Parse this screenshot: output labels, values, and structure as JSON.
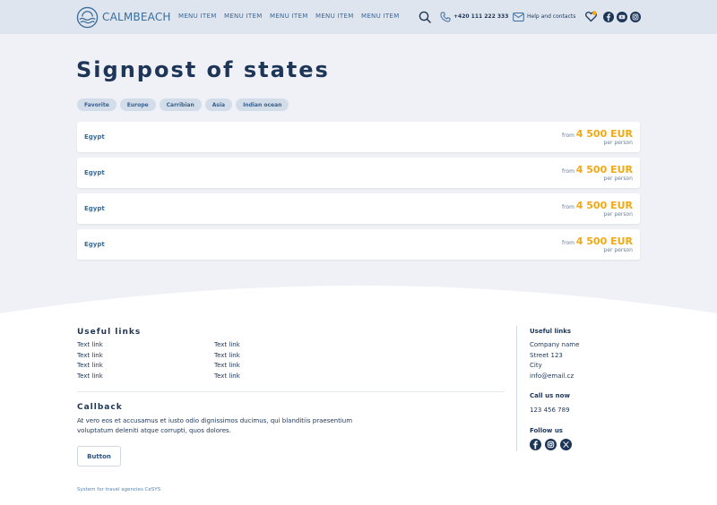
{
  "header": {
    "logo_text": "CALMBEACH",
    "menu": [
      "MENU ITEM",
      "MENU ITEM",
      "MENU ITEM",
      "MENU ITEM",
      "MENU ITEM"
    ],
    "phone": "+420 111 222 333",
    "help": "Help and contacts",
    "icons": [
      "search-icon",
      "phone-icon",
      "mail-icon",
      "heart-icon",
      "facebook-icon",
      "youtube-icon",
      "instagram-icon"
    ]
  },
  "main": {
    "title": "Signpost of states",
    "chips": [
      "Favorite",
      "Europe",
      "Carribian",
      "Asia",
      "Indian ocean"
    ],
    "cards": [
      {
        "name": "Egypt",
        "from": "from",
        "price": "4 500 EUR",
        "per": "per person"
      },
      {
        "name": "Egypt",
        "from": "from",
        "price": "4 500 EUR",
        "per": "per person"
      },
      {
        "name": "Egypt",
        "from": "from",
        "price": "4 500 EUR",
        "per": "per person"
      },
      {
        "name": "Egypt",
        "from": "from",
        "price": "4 500 EUR",
        "per": "per person"
      }
    ]
  },
  "footer": {
    "useful_links_title": "Useful links",
    "links_col1": [
      "Text link",
      "Text link",
      "Text link",
      "Text link"
    ],
    "links_col2": [
      "Text link",
      "Text link",
      "Text link",
      "Text link"
    ],
    "callback_title": "Callback",
    "callback_text": "At vero eos et accusamus et iusto odio dignissimos ducimus, qui blanditiis praesentium voluptatum deleniti atque corrupti, quos dolores.",
    "button_label": "Button",
    "right": {
      "title": "Useful links",
      "company": "Company name",
      "street": "Street 123",
      "city": "City",
      "email": "info@email.cz",
      "call_title": "Call us now",
      "phone": "123 456 789",
      "follow_title": "Follow us"
    },
    "bottom_text": "System for travel agencies CeSYS"
  },
  "colors": {
    "header_bg": "#dfe5ee",
    "page_bg": "#f0f1f6",
    "primary_text": "#1d3557",
    "accent_blue": "#3a6d9c",
    "price": "#f2a813",
    "chip_bg": "#d2dde9"
  }
}
